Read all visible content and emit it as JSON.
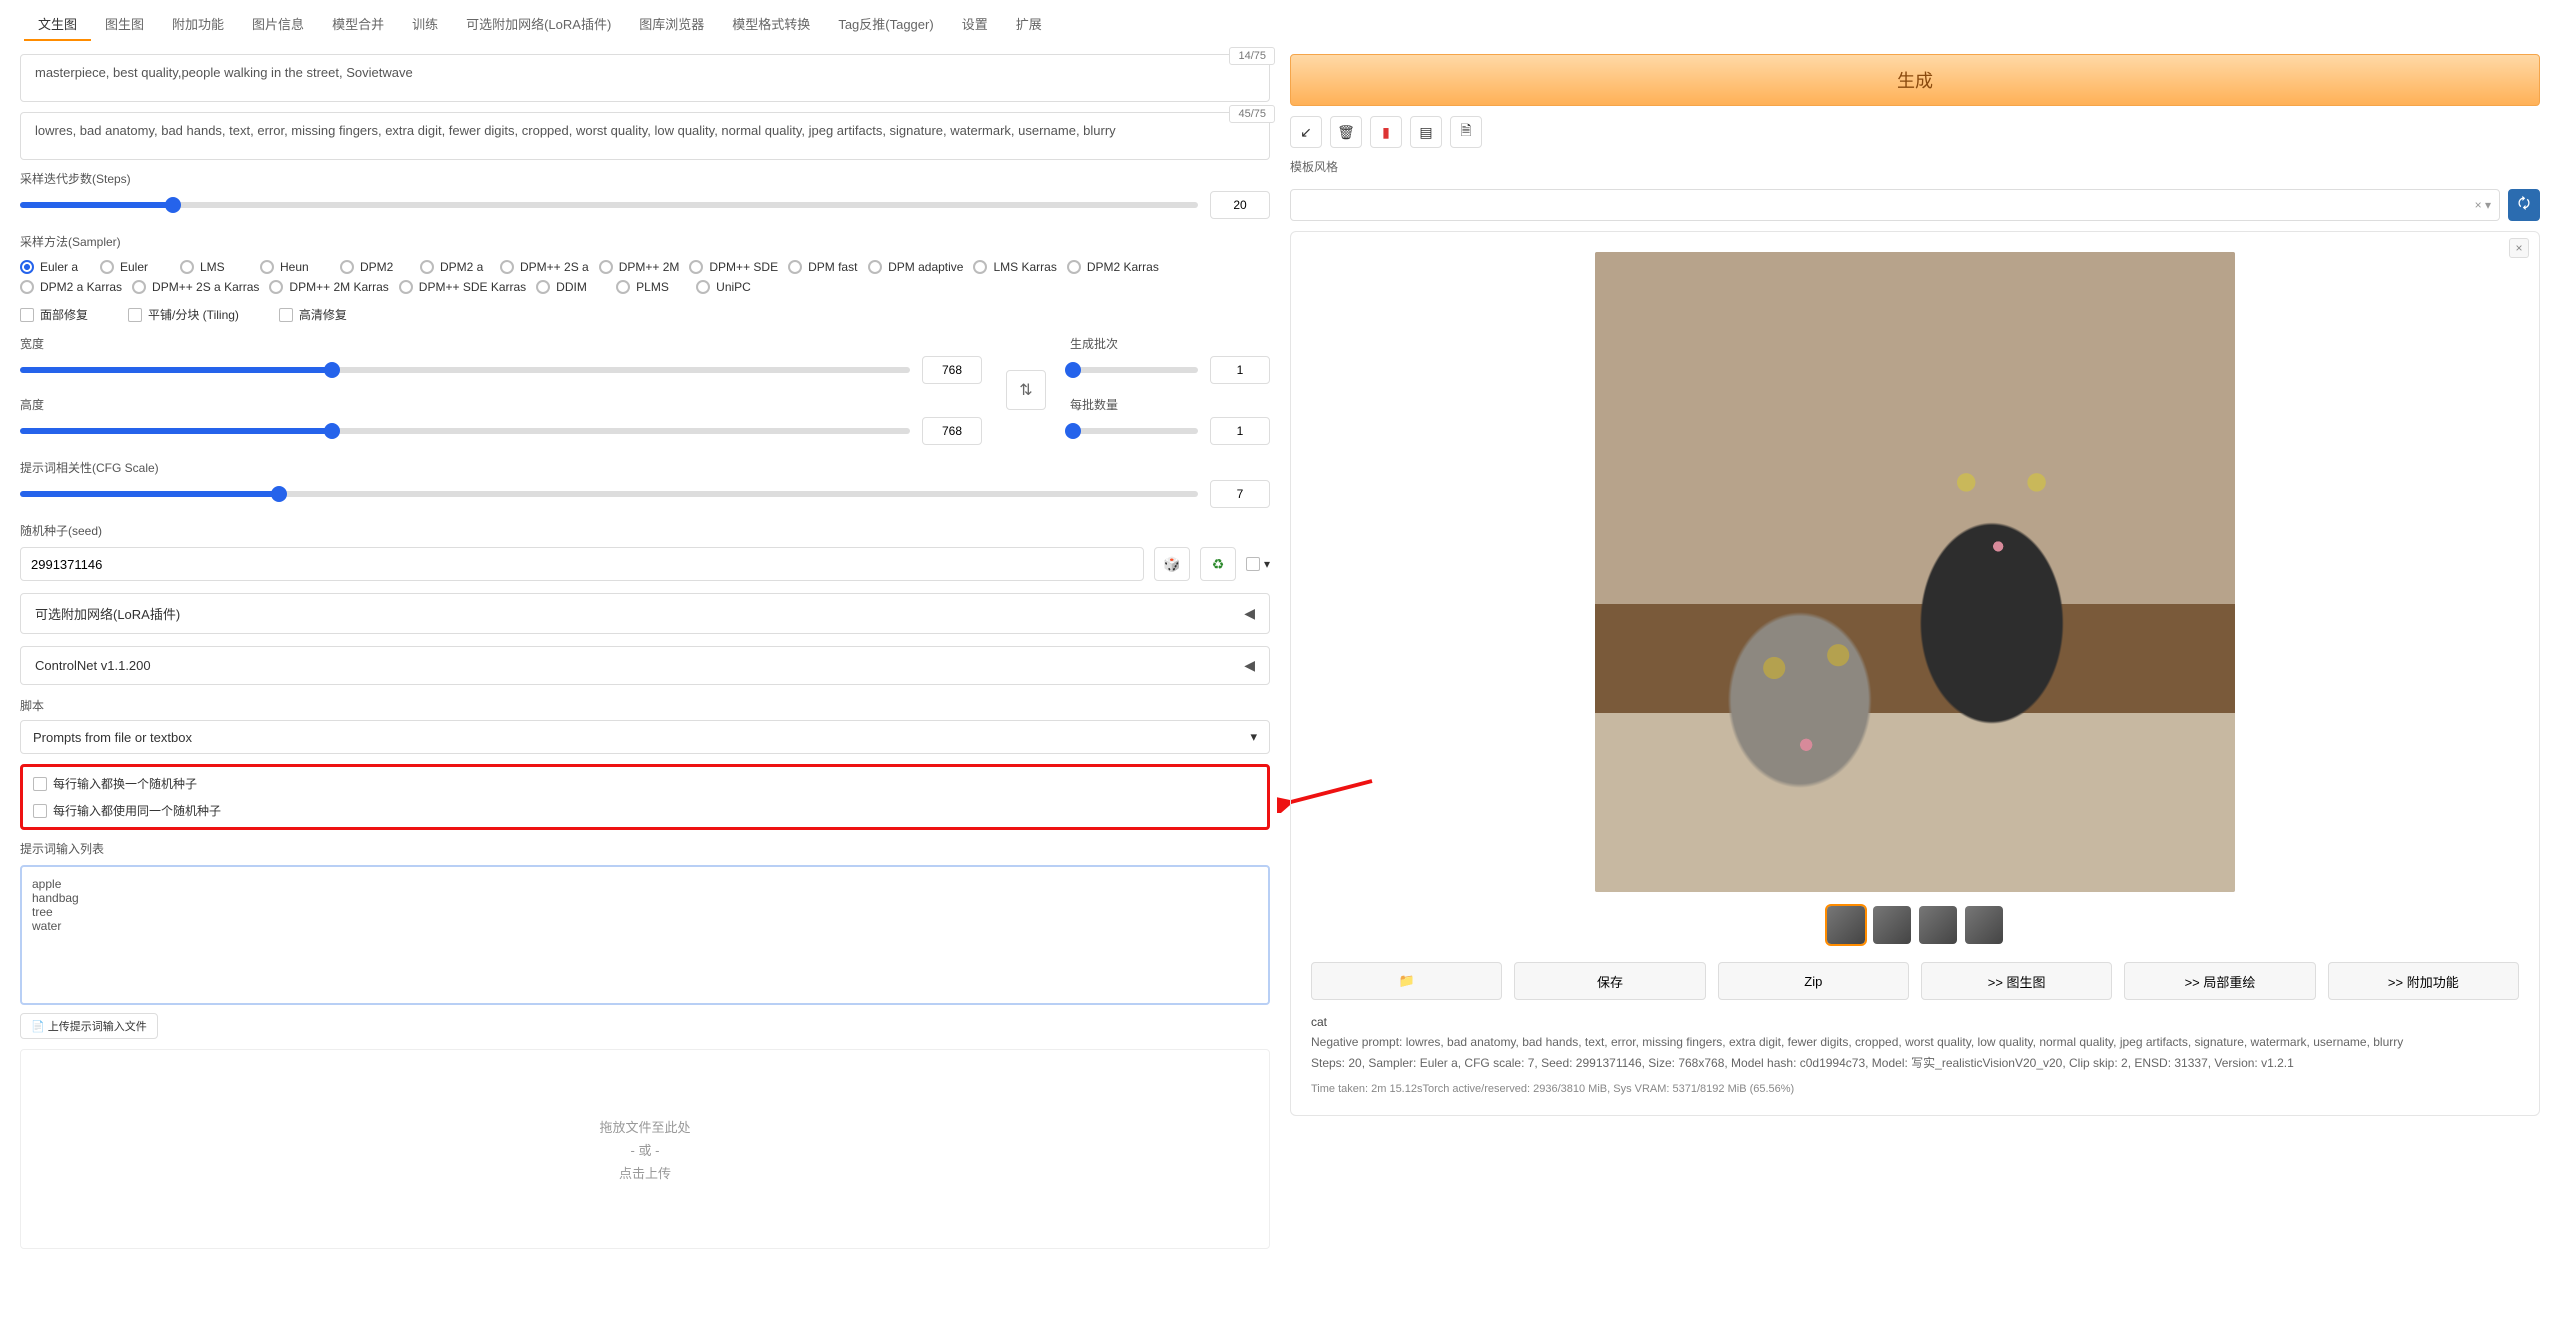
{
  "tabs": [
    "文生图",
    "图生图",
    "附加功能",
    "图片信息",
    "模型合并",
    "训练",
    "可选附加网络(LoRA插件)",
    "图库浏览器",
    "模型格式转换",
    "Tag反推(Tagger)",
    "设置",
    "扩展"
  ],
  "active_tab": 0,
  "prompt": {
    "positive": "masterpiece, best quality,people walking in the street, Sovietwave",
    "positive_count": "14/75",
    "negative": "lowres, bad anatomy, bad hands, text, error, missing fingers, extra digit, fewer digits, cropped, worst quality, low quality, normal quality, jpeg artifacts, signature, watermark, username, blurry",
    "negative_count": "45/75"
  },
  "gen": {
    "button": "生成",
    "template_label": "模板风格",
    "template_clear": "× ▾"
  },
  "steps": {
    "label": "采样迭代步数(Steps)",
    "value": "20",
    "pct": 13
  },
  "sampler": {
    "label": "采样方法(Sampler)",
    "items": [
      "Euler a",
      "Euler",
      "LMS",
      "Heun",
      "DPM2",
      "DPM2 a",
      "DPM++ 2S a",
      "DPM++ 2M",
      "DPM++ SDE",
      "DPM fast",
      "DPM adaptive",
      "LMS Karras",
      "DPM2 Karras",
      "DPM2 a Karras",
      "DPM++ 2S a Karras",
      "DPM++ 2M Karras",
      "DPM++ SDE Karras",
      "DDIM",
      "PLMS",
      "UniPC"
    ],
    "selected": "Euler a"
  },
  "checks": {
    "face": "面部修复",
    "tiling": "平铺/分块 (Tiling)",
    "hires": "高清修复"
  },
  "width": {
    "label": "宽度",
    "value": "768",
    "pct": 35
  },
  "height": {
    "label": "高度",
    "value": "768",
    "pct": 35
  },
  "batch_count": {
    "label": "生成批次",
    "value": "1",
    "pct": 0
  },
  "batch_size": {
    "label": "每批数量",
    "value": "1",
    "pct": 0
  },
  "cfg": {
    "label": "提示词相关性(CFG Scale)",
    "value": "7",
    "pct": 22
  },
  "seed": {
    "label": "随机种子(seed)",
    "value": "2991371146",
    "dice": "🎲",
    "recycle": "♻",
    "extra": "▾"
  },
  "accordions": {
    "lora": "可选附加网络(LoRA插件)",
    "controlnet": "ControlNet v1.1.200"
  },
  "script": {
    "label": "脚本",
    "value": "Prompts from file or textbox"
  },
  "script_opts": {
    "rand_seed": "每行输入都换一个随机种子",
    "same_seed": "每行输入都使用同一个随机种子",
    "input_label": "提示词输入列表",
    "input_value": "apple\nhandbag\ntree\nwater",
    "upload_btn": "📄 上传提示词输入文件",
    "drop1": "拖放文件至此处",
    "drop2": "- 或 -",
    "drop3": "点击上传"
  },
  "actions": {
    "folder": "📁",
    "save": "保存",
    "zip": "Zip",
    "img2img": ">> 图生图",
    "inpaint": ">> 局部重绘",
    "extras": ">> 附加功能"
  },
  "result": {
    "prompt_line": "cat",
    "neg_line": "Negative prompt: lowres, bad anatomy, bad hands, text, error, missing fingers, extra digit, fewer digits, cropped, worst quality, low quality, normal quality, jpeg artifacts, signature, watermark, username, blurry",
    "params_line": "Steps: 20, Sampler: Euler a, CFG scale: 7, Seed: 2991371146, Size: 768x768, Model hash: c0d1994c73, Model: 写实_realisticVisionV20_v20, Clip skip: 2, ENSD: 31337, Version: v1.2.1",
    "time_line": "Time taken: 2m 15.12sTorch active/reserved: 2936/3810 MiB, Sys VRAM: 5371/8192 MiB (65.56%)"
  }
}
